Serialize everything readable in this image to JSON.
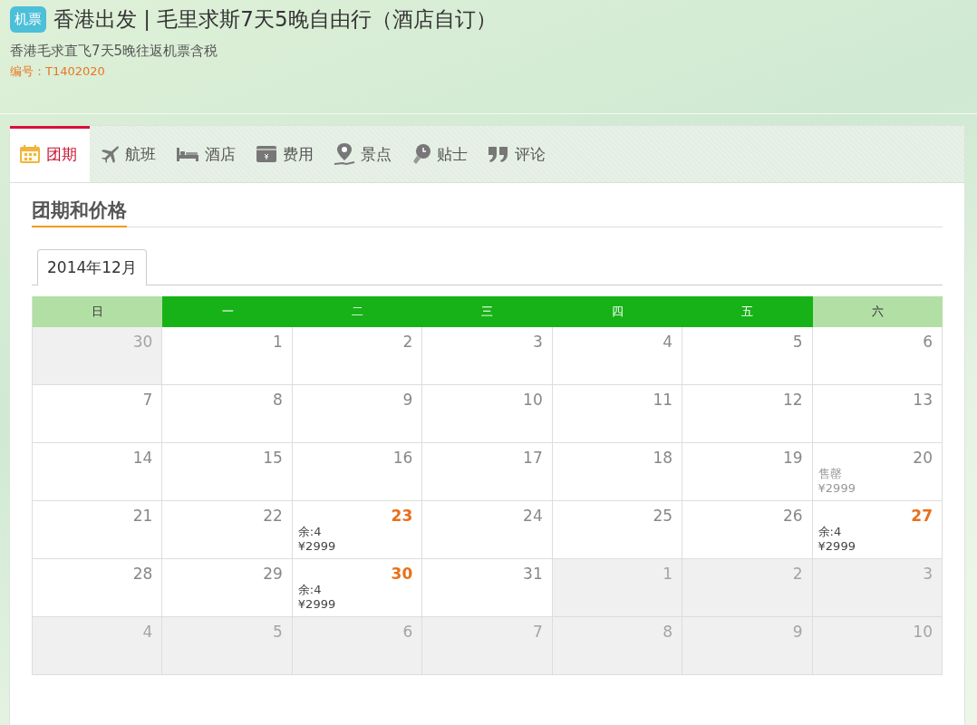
{
  "header": {
    "badge": "机票",
    "title": "香港出发 | 毛里求斯7天5晚自由行（酒店自订）",
    "subtitle": "香港毛求直飞7天5晚往返机票含税",
    "code": "编号：T1402020"
  },
  "tabs": [
    {
      "label": "团期",
      "kind": "calendar",
      "selected": true
    },
    {
      "label": "航班",
      "kind": "plane",
      "selected": false
    },
    {
      "label": "酒店",
      "kind": "bed",
      "selected": false
    },
    {
      "label": "费用",
      "kind": "money",
      "selected": false
    },
    {
      "label": "景点",
      "kind": "pin",
      "selected": false
    },
    {
      "label": "贴士",
      "kind": "bulb",
      "selected": false
    },
    {
      "label": "评论",
      "kind": "quote",
      "selected": false
    }
  ],
  "section_title": "团期和价格",
  "month_tabs": [
    {
      "label": "2014年12月",
      "selected": true
    }
  ],
  "weekdays": [
    {
      "label": "日",
      "weekend": true
    },
    {
      "label": "一",
      "weekend": false
    },
    {
      "label": "二",
      "weekend": false
    },
    {
      "label": "三",
      "weekend": false
    },
    {
      "label": "四",
      "weekend": false
    },
    {
      "label": "五",
      "weekend": false
    },
    {
      "label": "六",
      "weekend": true
    }
  ],
  "weeks": [
    [
      {
        "day": "30",
        "kind": "other"
      },
      {
        "day": "1",
        "kind": "normal"
      },
      {
        "day": "2",
        "kind": "normal"
      },
      {
        "day": "3",
        "kind": "normal"
      },
      {
        "day": "4",
        "kind": "normal"
      },
      {
        "day": "5",
        "kind": "normal"
      },
      {
        "day": "6",
        "kind": "normal"
      }
    ],
    [
      {
        "day": "7",
        "kind": "normal"
      },
      {
        "day": "8",
        "kind": "normal"
      },
      {
        "day": "9",
        "kind": "normal"
      },
      {
        "day": "10",
        "kind": "normal"
      },
      {
        "day": "11",
        "kind": "normal"
      },
      {
        "day": "12",
        "kind": "normal"
      },
      {
        "day": "13",
        "kind": "normal"
      }
    ],
    [
      {
        "day": "14",
        "kind": "normal"
      },
      {
        "day": "15",
        "kind": "normal"
      },
      {
        "day": "16",
        "kind": "normal"
      },
      {
        "day": "17",
        "kind": "normal"
      },
      {
        "day": "18",
        "kind": "normal"
      },
      {
        "day": "19",
        "kind": "normal"
      },
      {
        "day": "20",
        "kind": "soldout",
        "status": "售罄",
        "price": "¥2999"
      }
    ],
    [
      {
        "day": "21",
        "kind": "normal"
      },
      {
        "day": "22",
        "kind": "normal"
      },
      {
        "day": "23",
        "kind": "available",
        "status": "余:4",
        "price": "¥2999"
      },
      {
        "day": "24",
        "kind": "normal"
      },
      {
        "day": "25",
        "kind": "normal"
      },
      {
        "day": "26",
        "kind": "normal"
      },
      {
        "day": "27",
        "kind": "available",
        "status": "余:4",
        "price": "¥2999"
      }
    ],
    [
      {
        "day": "28",
        "kind": "normal"
      },
      {
        "day": "29",
        "kind": "normal"
      },
      {
        "day": "30",
        "kind": "available",
        "status": "余:4",
        "price": "¥2999"
      },
      {
        "day": "31",
        "kind": "normal"
      },
      {
        "day": "1",
        "kind": "other"
      },
      {
        "day": "2",
        "kind": "other"
      },
      {
        "day": "3",
        "kind": "other"
      }
    ],
    [
      {
        "day": "4",
        "kind": "other"
      },
      {
        "day": "5",
        "kind": "other"
      },
      {
        "day": "6",
        "kind": "other"
      },
      {
        "day": "7",
        "kind": "other"
      },
      {
        "day": "8",
        "kind": "other"
      },
      {
        "day": "9",
        "kind": "other"
      },
      {
        "day": "10",
        "kind": "other"
      }
    ]
  ]
}
